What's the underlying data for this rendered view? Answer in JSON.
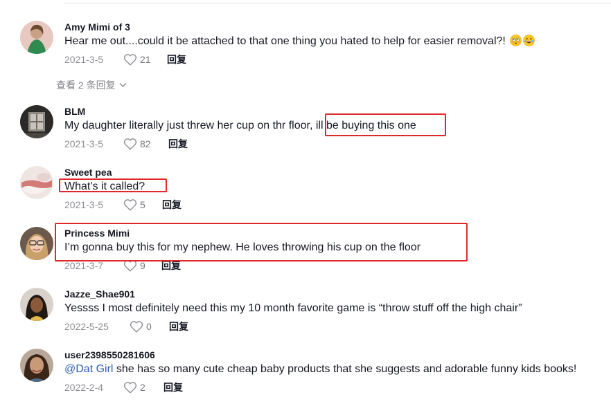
{
  "colors": {
    "text": "#161823",
    "muted": "rgba(22,24,35,0.5)",
    "mention": "#2b5db9",
    "highlight_box": "#e0282b"
  },
  "comments": [
    {
      "username": "Amy Mimi of 3",
      "text": "Hear me out....could it be attached to that one thing you hated to help for easier removal?! ",
      "emoji_icons": [
        "flushed-face-icon",
        "grinning-face-icon"
      ],
      "date": "2021-3-5",
      "likes": "21",
      "reply_label": "回复"
    },
    {
      "username": "BLM",
      "text": "My daughter literally just threw her cup on thr floor, ill be buying this one",
      "date": "2021-3-5",
      "likes": "82",
      "reply_label": "回复"
    },
    {
      "username": "Sweet pea",
      "text": "What’s it called?",
      "date": "2021-3-5",
      "likes": "5",
      "reply_label": "回复"
    },
    {
      "username": "Princess Mimi",
      "text": "I’m gonna buy this for my nephew. He loves throwing his cup on the floor",
      "date": "2021-3-7",
      "likes": "9",
      "reply_label": "回复"
    },
    {
      "username": "Jazze_Shae901",
      "text": "Yessss I most definitely need this my 10 month favorite game is “throw stuff off the high chair”",
      "date": "2022-5-25",
      "likes": "0",
      "reply_label": "回复"
    },
    {
      "username": "user2398550281606",
      "mention": "@Dat Girl",
      "text": " she has so many cute cheap baby products that she suggests and adorable funny kids books!",
      "date": "2022-2-4",
      "likes": "2",
      "reply_label": "回复"
    }
  ],
  "view_replies_label": "查看 2 条回复",
  "icons": {
    "like": "heart-outline-icon",
    "expand": "chevron-down-icon"
  }
}
